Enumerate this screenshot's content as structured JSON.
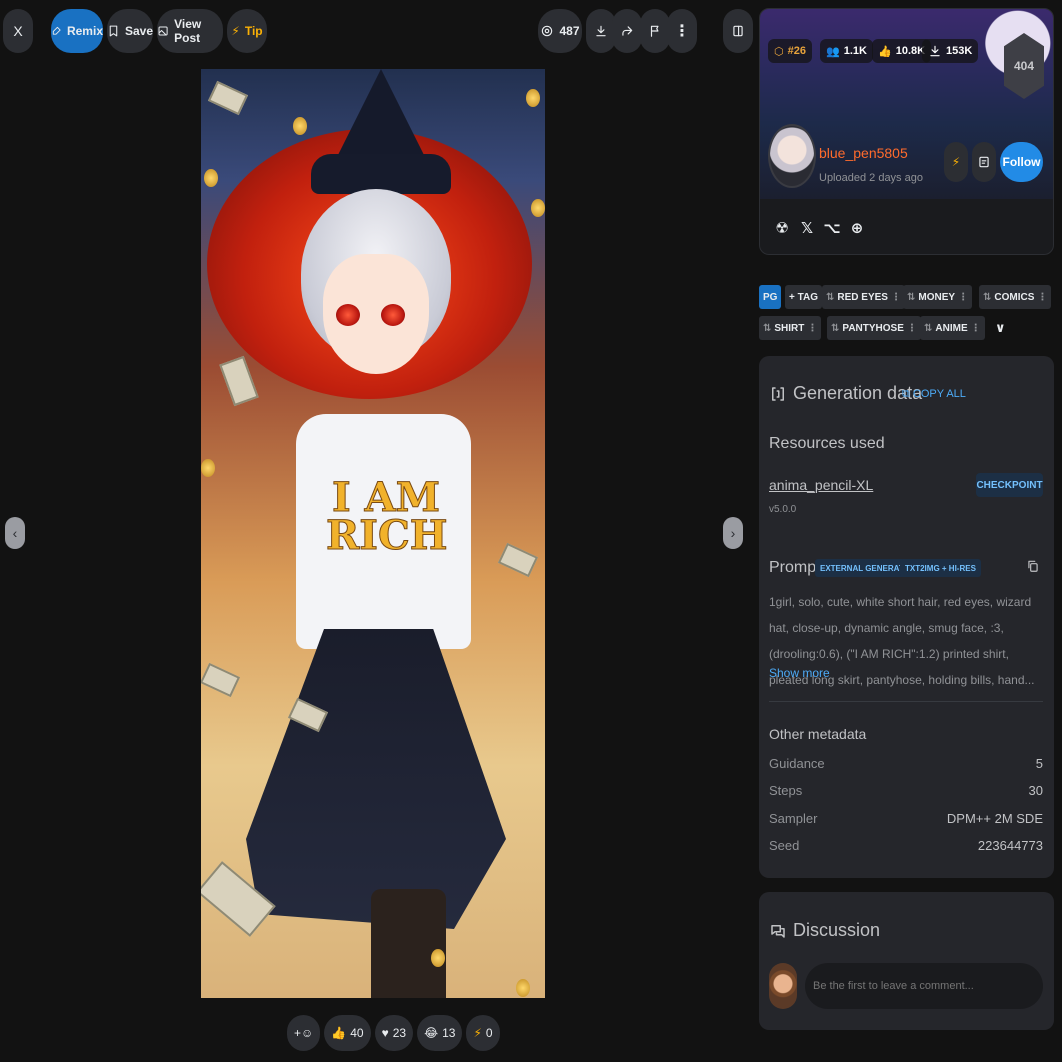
{
  "toolbar": {
    "close_label": "X",
    "remix_label": "Remix",
    "save_label": "Save",
    "view_post_label": "View Post",
    "tip_label": "Tip",
    "views_count": "487"
  },
  "image": {
    "shirt_text_line1": "I AM",
    "shirt_text_line2": "RICH"
  },
  "reactions": {
    "add_label": "+☺",
    "like": "40",
    "heart": "23",
    "laugh": "13",
    "buzz": "0"
  },
  "profile": {
    "rank": "#26",
    "followers": "1.1K",
    "likes": "10.8K",
    "downloads": "153K",
    "rank_badge": "404",
    "username": "blue_pen5805",
    "uploaded": "Uploaded 2 days ago",
    "follow_label": "Follow",
    "socials": [
      "☢",
      "𝕏",
      "⌥",
      "⊕"
    ]
  },
  "tags": {
    "rating": "PG",
    "add_tag": "+ TAG",
    "items": [
      "RED EYES",
      "MONEY",
      "COMICS",
      "SHIRT",
      "PANTYHOSE",
      "ANIME"
    ],
    "expand": "∨"
  },
  "generation": {
    "title": "Generation data",
    "copy_all": "COPY ALL",
    "resources_title": "Resources used",
    "resource_name": "anima_pencil-XL",
    "resource_version": "v5.0.0",
    "resource_type": "CHECKPOINT",
    "prompt_title": "Prompt",
    "prompt_badge_1": "EXTERNAL GENERATOR",
    "prompt_badge_2": "TXT2IMG + HI-RES",
    "prompt_text": "1girl, solo, cute, white short hair, red eyes, wizard hat, close-up, dynamic angle, smug face, :3, (drooling:0.6), (\"I AM RICH\":1.2) printed shirt, pleated long skirt, pantyhose, holding bills, hand...",
    "show_more": "Show more",
    "other_title": "Other metadata",
    "meta": [
      {
        "key": "Guidance",
        "value": "5"
      },
      {
        "key": "Steps",
        "value": "30"
      },
      {
        "key": "Sampler",
        "value": "DPM++ 2M SDE"
      },
      {
        "key": "Seed",
        "value": "223644773"
      }
    ]
  },
  "discussion": {
    "title": "Discussion",
    "placeholder": "Be the first to leave a comment..."
  },
  "colors": {
    "accent": "#228be6",
    "username": "#ff6b2c",
    "background": "#121212",
    "card": "#25262b"
  }
}
